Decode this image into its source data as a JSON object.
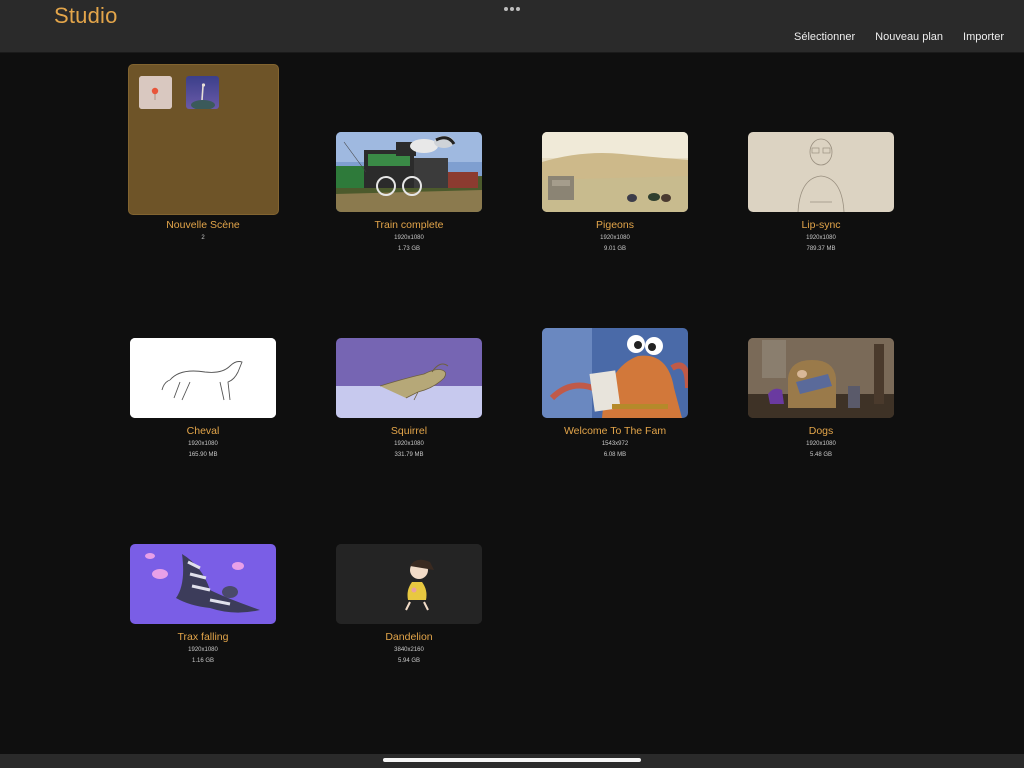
{
  "app": {
    "title": "Studio"
  },
  "toolbar": {
    "select_label": "Sélectionner",
    "new_plan_label": "Nouveau plan",
    "import_label": "Importer"
  },
  "folder": {
    "name": "Nouvelle Scène",
    "count": "2",
    "color": "#6e5428"
  },
  "items": [
    {
      "name": "Train complete",
      "resolution": "1920x1080",
      "size": "1.73 GB"
    },
    {
      "name": "Pigeons",
      "resolution": "1920x1080",
      "size": "9.01 GB"
    },
    {
      "name": "Lip-sync",
      "resolution": "1920x1080",
      "size": "789.37 MB"
    },
    {
      "name": "Cheval",
      "resolution": "1920x1080",
      "size": "165.90 MB"
    },
    {
      "name": "Squirrel",
      "resolution": "1920x1080",
      "size": "331.79 MB"
    },
    {
      "name": "Welcome To The Fam",
      "resolution": "1543x972",
      "size": "6.08 MB"
    },
    {
      "name": "Dogs",
      "resolution": "1920x1080",
      "size": "5.48 GB"
    },
    {
      "name": "Trax falling",
      "resolution": "1920x1080",
      "size": "1.16 GB"
    },
    {
      "name": "Dandelion",
      "resolution": "3840x2160",
      "size": "5.94 GB"
    }
  ],
  "theme": {
    "accent": "#e3a54a",
    "header_bg": "#2a2a2a",
    "page_bg": "#0f0f0f"
  }
}
